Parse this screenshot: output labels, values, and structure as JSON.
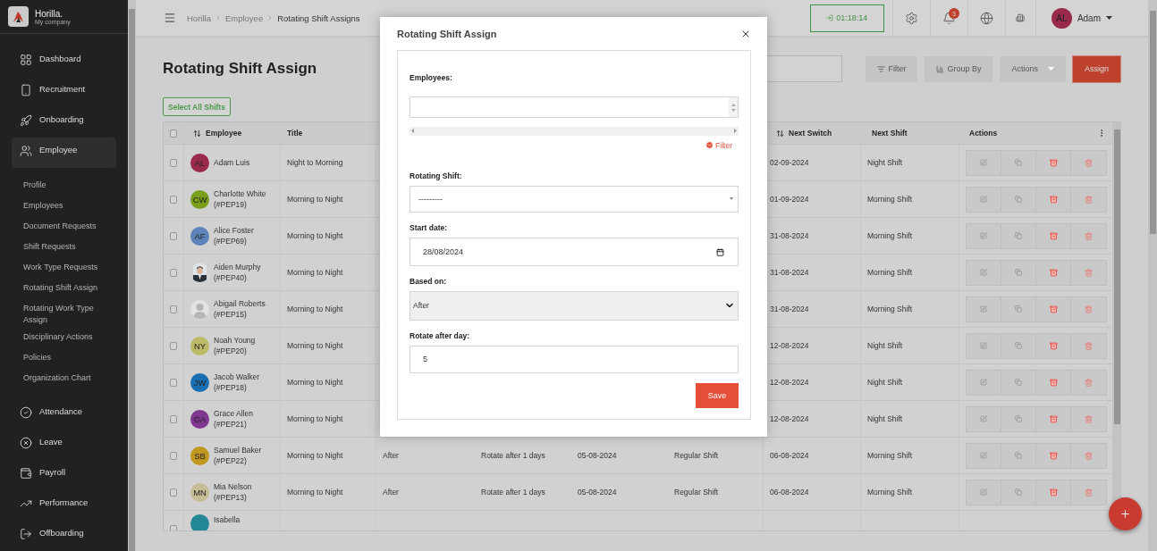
{
  "sidebar": {
    "brand": {
      "name": "Horilla.",
      "company": "My company"
    },
    "items": [
      {
        "label": "Dashboard",
        "selected": false
      },
      {
        "label": "Recruitment",
        "selected": false
      },
      {
        "label": "Onboarding",
        "selected": false
      },
      {
        "label": "Employee",
        "selected": true,
        "children": [
          "Profile",
          "Employees",
          "Document Requests",
          "Shift Requests",
          "Work Type Requests",
          "Rotating Shift Assign",
          "Rotating Work Type Assign",
          "Disciplinary Actions",
          "Policies",
          "Organization Chart"
        ]
      },
      {
        "label": "Attendance",
        "selected": false
      },
      {
        "label": "Leave",
        "selected": false
      },
      {
        "label": "Payroll",
        "selected": false
      },
      {
        "label": "Performance",
        "selected": false
      },
      {
        "label": "Offboarding",
        "selected": false
      }
    ]
  },
  "header": {
    "breadcrumb": [
      "Horilla",
      "Employee",
      "Rotating Shift Assigns"
    ],
    "timer": "01:18:14",
    "notification_count": "3",
    "user": {
      "initials": "AL",
      "name": "Adam",
      "color": "#992a4b"
    }
  },
  "page": {
    "title": "Rotating Shift Assign",
    "toolbar": [
      {
        "label": "Filter",
        "kind": "filter"
      },
      {
        "label": "Group By",
        "kind": "group"
      },
      {
        "label": "Actions",
        "kind": "dropdown"
      },
      {
        "label": "Assign",
        "kind": "primary"
      }
    ],
    "select_all": "Select All Shifts"
  },
  "table": {
    "header_checked": false,
    "columns": {
      "employee": {
        "label": "Employee",
        "sortable": true
      },
      "title": {
        "label": "Title",
        "sortable": false
      },
      "next_switch": {
        "label": "Next Switch",
        "sortable": true
      },
      "next_shift": {
        "label": "Next Shift",
        "sortable": false
      },
      "actions": {
        "label": "Actions"
      }
    },
    "rows": [
      {
        "name": "Adam Luis",
        "avatar": {
          "kind": "initials",
          "initials": "AL",
          "color": "#992a4b"
        },
        "title": "Night to Morning",
        "next_switch": "02-09-2024",
        "next_shift": "Night Shift",
        "checked": false
      },
      {
        "name": "Charlotte White",
        "code": "(#PEP19)",
        "avatar": {
          "kind": "initials",
          "initials": "CW",
          "color": "#7a9f1a"
        },
        "title": "Morning to Night",
        "next_switch": "01-09-2024",
        "next_shift": "Morning Shift",
        "checked": false
      },
      {
        "name": "Alice Foster",
        "code": "(#PEP69)",
        "avatar": {
          "kind": "initials",
          "initials": "AF",
          "color": "#5c84ba"
        },
        "title": "Morning to Night",
        "next_switch": "31-08-2024",
        "next_shift": "Morning Shift",
        "checked": false
      },
      {
        "name": "Aiden Murphy",
        "code": "(#PEP40)",
        "title": "Morning to Night",
        "next_switch": "31-08-2024",
        "next_shift": "Morning Shift",
        "checked": false
      },
      {
        "name": "Abigail Roberts",
        "code": "(#PEP15)",
        "avatar": {
          "kind": "silhouette"
        },
        "title": "Morning to Night",
        "next_switch": "31-08-2024",
        "next_shift": "Morning Shift",
        "checked": false
      },
      {
        "name": "Noah Young",
        "code": "(#PEP20)",
        "avatar": {
          "kind": "initials",
          "initials": "NY",
          "color": "#bcb967"
        },
        "title": "Morning to Night",
        "next_switch": "12-08-2024",
        "next_shift": "Night Shift",
        "checked": false
      },
      {
        "name": "Jacob Walker",
        "code": "(#PEP18)",
        "avatar": {
          "kind": "initials",
          "initials": "JW",
          "color": "#1a6fb2"
        },
        "title": "Morning to Night",
        "next_switch": "12-08-2024",
        "next_shift": "Night Shift",
        "checked": false
      },
      {
        "name": "Grace Allen",
        "code": "(#PEP21)",
        "avatar": {
          "kind": "initials",
          "initials": "GA",
          "color": "#80378f"
        },
        "title": "Morning to Night",
        "next_switch": "12-08-2024",
        "next_shift": "Night Shift",
        "checked": false
      },
      {
        "name": "Samuel Baker",
        "code": "(#PEP22)",
        "avatar": {
          "kind": "initials",
          "initials": "SB",
          "color": "#c1981f"
        },
        "title": "Morning to Night",
        "column_3": "After",
        "column_4": "Rotate after 1 days",
        "column_5": "05-08-2024",
        "column_6": "Regular Shift",
        "next_switch": "06-08-2024",
        "next_shift": "Morning Shift",
        "checked": false
      },
      {
        "name": "Mia Nelson",
        "code": "(#PEP13)",
        "avatar": {
          "kind": "initials",
          "initials": "MN",
          "color": "#c5bd95"
        },
        "title": "Morning to Night",
        "column_3": "After",
        "column_4": "Rotate after 1 days",
        "column_5": "05-08-2024",
        "column_6": "Regular Shift",
        "next_switch": "06-08-2024",
        "next_shift": "Morning Shift",
        "checked": false
      },
      {
        "name": "Isabella",
        "avatar": {
          "kind": "initials",
          "color": "#238796"
        },
        "checked": false
      }
    ]
  },
  "modal": {
    "title": "Rotating Shift Assign",
    "filter_link": "Filter",
    "fields": [
      {
        "kind": "multiselect",
        "label": "Employees:"
      },
      {
        "kind": "select",
        "label": "Rotating Shift:",
        "value": "---------"
      },
      {
        "kind": "date",
        "label": "Start date:",
        "value": "28/08/2024"
      },
      {
        "kind": "native_select",
        "label": "Based on:",
        "value": "After"
      },
      {
        "kind": "number",
        "label": "Rotate after day:",
        "value": "5"
      }
    ],
    "save": "Save"
  }
}
